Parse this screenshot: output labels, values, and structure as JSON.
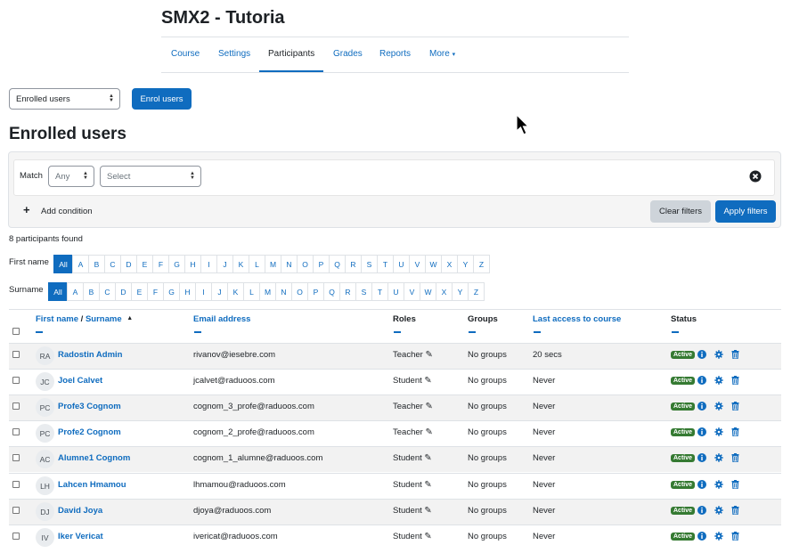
{
  "course": {
    "title": "SMX2 - Tutoria"
  },
  "nav": {
    "tabs": [
      "Course",
      "Settings",
      "Participants",
      "Grades",
      "Reports",
      "More"
    ]
  },
  "enrol_select": {
    "value": "Enrolled users"
  },
  "enrol_button": {
    "label": "Enrol users"
  },
  "page": {
    "heading": "Enrolled users"
  },
  "filter": {
    "match_label": "Match",
    "match_value": "Any",
    "type_value": "Select",
    "add_condition": "Add condition",
    "clear_label": "Clear filters",
    "apply_label": "Apply filters"
  },
  "participants_count": "8 participants found",
  "initials_bar": {
    "firstname_label": "First name",
    "surname_label": "Surname",
    "letters": [
      "All",
      "A",
      "B",
      "C",
      "D",
      "E",
      "F",
      "G",
      "H",
      "I",
      "J",
      "K",
      "L",
      "M",
      "N",
      "O",
      "P",
      "Q",
      "R",
      "S",
      "T",
      "U",
      "V",
      "W",
      "X",
      "Y",
      "Z"
    ]
  },
  "table": {
    "headers": {
      "first_name": "First name",
      "separator": " / ",
      "surname": "Surname",
      "email": "Email address",
      "roles": "Roles",
      "groups": "Groups",
      "last_access": "Last access to course",
      "status": "Status"
    },
    "rows": [
      {
        "initials": "RA",
        "name": "Radostin Admin",
        "email": "rivanov@iesebre.com",
        "role": "Teacher",
        "groups": "No groups",
        "last_access": "20 secs",
        "status": "Active"
      },
      {
        "initials": "JC",
        "name": "Joel Calvet",
        "email": "jcalvet@raduoos.com",
        "role": "Student",
        "groups": "No groups",
        "last_access": "Never",
        "status": "Active"
      },
      {
        "initials": "PC",
        "name": "Profe3 Cognom",
        "email": "cognom_3_profe@raduoos.com",
        "role": "Teacher",
        "groups": "No groups",
        "last_access": "Never",
        "status": "Active"
      },
      {
        "initials": "PC",
        "name": "Profe2 Cognom",
        "email": "cognom_2_profe@raduoos.com",
        "role": "Teacher",
        "groups": "No groups",
        "last_access": "Never",
        "status": "Active"
      },
      {
        "initials": "AC",
        "name": "Alumne1 Cognom",
        "email": "cognom_1_alumne@raduoos.com",
        "role": "Student",
        "groups": "No groups",
        "last_access": "Never",
        "status": "Active"
      },
      {
        "initials": "LH",
        "name": "Lahcen Hmamou",
        "email": "lhmamou@raduoos.com",
        "role": "Student",
        "groups": "No groups",
        "last_access": "Never",
        "status": "Active"
      },
      {
        "initials": "DJ",
        "name": "David Joya",
        "email": "djoya@raduoos.com",
        "role": "Student",
        "groups": "No groups",
        "last_access": "Never",
        "status": "Active"
      },
      {
        "initials": "IV",
        "name": "Iker Vericat",
        "email": "ivericat@raduoos.com",
        "role": "Student",
        "groups": "No groups",
        "last_access": "Never",
        "status": "Active"
      }
    ]
  },
  "colors": {
    "accent": "#0f6cbf",
    "active_badge": "#357a32"
  }
}
